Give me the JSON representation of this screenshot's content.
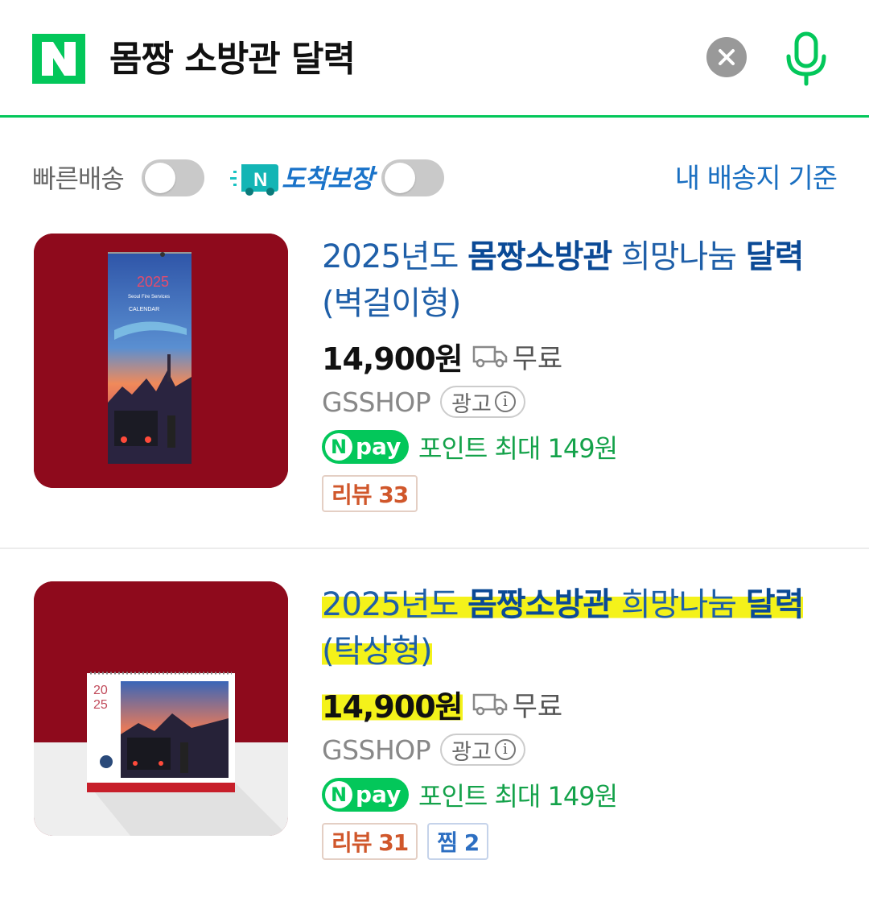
{
  "search": {
    "query": "몸짱 소방관 달력"
  },
  "filters": {
    "fast_delivery_label": "빠른배송",
    "arrival_guarantee_label": "도착보장",
    "address_link": "내 배송지 기준"
  },
  "products": [
    {
      "title_prefix": "2025년도 ",
      "title_kw1": "몸짱소방관",
      "title_mid": " 희망나눔 ",
      "title_kw2": "달력",
      "title_line2": "(벽걸이형)",
      "price": "14,900원",
      "shipping": "무료",
      "seller": "GSSHOP",
      "ad_label": "광고",
      "pay_badge": "pay",
      "points": "포인트 최대 149원",
      "review": "리뷰 33",
      "thumb_year": "2025",
      "thumb_sub1": "Seoul Fire Services",
      "thumb_sub2": "CALENDAR"
    },
    {
      "title_prefix": "2025년도 ",
      "title_kw1": "몸짱소방관",
      "title_mid": " 희망나눔 ",
      "title_kw2": "달력",
      "title_line2": "(탁상형)",
      "price": "14,900원",
      "shipping": "무료",
      "seller": "GSSHOP",
      "ad_label": "광고",
      "pay_badge": "pay",
      "points": "포인트 최대 149원",
      "review": "리뷰 31",
      "zzim": "찜 2",
      "thumb_year1": "20",
      "thumb_year2": "25"
    }
  ],
  "colors": {
    "naver_green": "#03c75a",
    "link_blue": "#1f5fa8",
    "highlight": "#f4f21a"
  },
  "icons": [
    "naver-n-logo",
    "clear-icon",
    "microphone-icon",
    "truck-icon",
    "info-icon"
  ]
}
